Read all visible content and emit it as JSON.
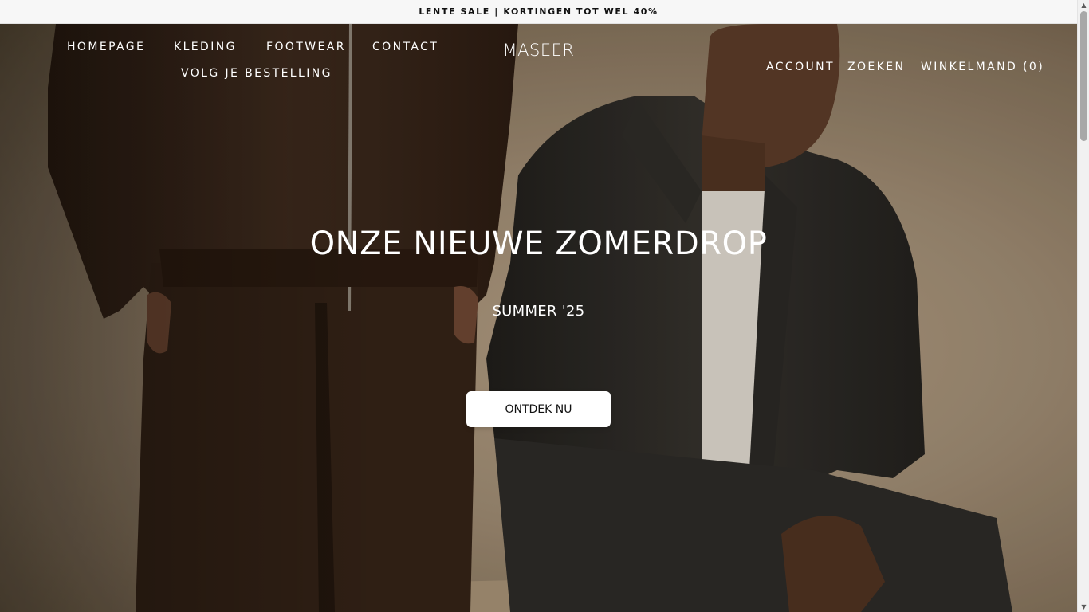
{
  "announcement": {
    "text": "LENTE SALE | KORTINGEN TOT WEL 40%"
  },
  "header": {
    "nav": [
      {
        "label": "HOMEPAGE"
      },
      {
        "label": "KLEDING"
      },
      {
        "label": "FOOTWEAR"
      },
      {
        "label": "CONTACT"
      },
      {
        "label": "VOLG JE BESTELLING"
      }
    ],
    "logo": "MASEER",
    "account_label": "ACCOUNT",
    "search_label": "ZOEKEN",
    "cart_label": "WINKELMAND (0)"
  },
  "hero": {
    "title": "ONZE NIEUWE ZOMERDROP",
    "subtitle": "SUMMER '25",
    "cta_label": "ONTDEK NU"
  },
  "icons": {
    "scroll_up": "chevron-up-icon",
    "scroll_down": "chevron-down-icon"
  }
}
